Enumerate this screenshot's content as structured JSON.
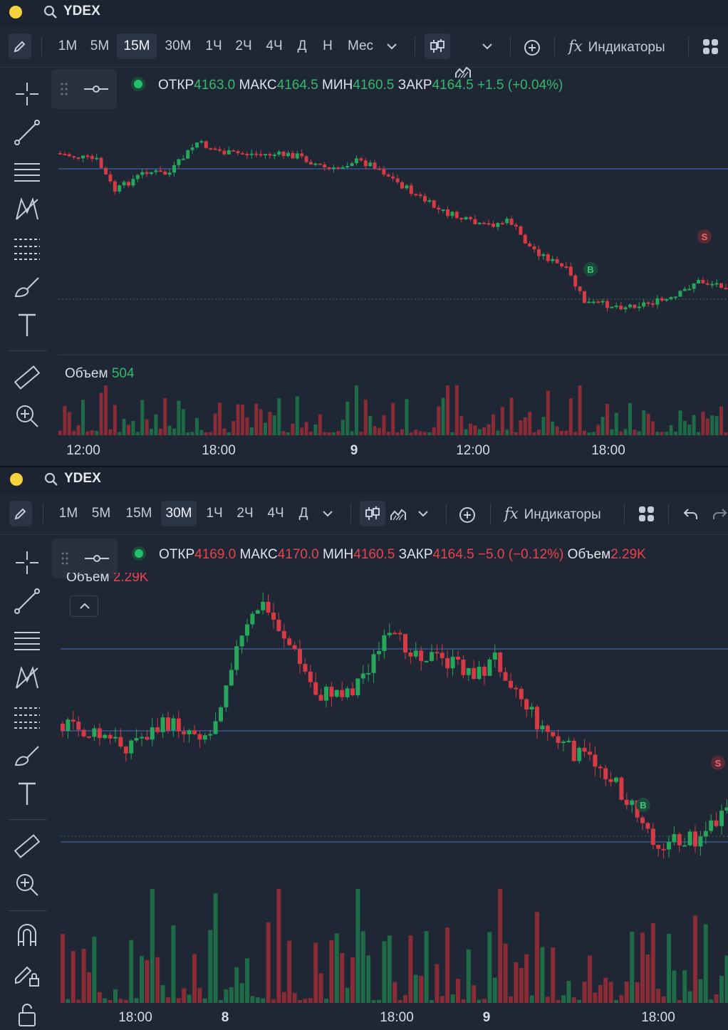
{
  "panels": [
    {
      "ticker": "YDEX",
      "timeframes": [
        "1М",
        "5М",
        "15М",
        "30М",
        "1Ч",
        "2Ч",
        "4Ч",
        "Д",
        "Н",
        "Мес"
      ],
      "active_timeframe": "15М",
      "indicators_label": "Индикаторы",
      "ohlc": {
        "open_label": "ОТКР",
        "open": "4163.0",
        "high_label": "МАКС",
        "high": "4164.5",
        "low_label": "МИН",
        "low": "4160.5",
        "close_label": "ЗАКР",
        "close": "4164.5",
        "change": "+1.5 (+0.04%)",
        "color": "green"
      },
      "volume_label": "Объем",
      "volume_value": "504",
      "x_axis": [
        "12:00",
        "18:00",
        "9",
        "12:00",
        "18:00"
      ],
      "markers": [
        "B",
        "S"
      ]
    },
    {
      "ticker": "YDEX",
      "timeframes": [
        "1М",
        "5М",
        "15М",
        "30М",
        "1Ч",
        "2Ч",
        "4Ч",
        "Д"
      ],
      "active_timeframe": "30М",
      "indicators_label": "Индикаторы",
      "ohlc": {
        "open_label": "ОТКР",
        "open": "4169.0",
        "high_label": "МАКС",
        "high": "4170.0",
        "low_label": "МИН",
        "low": "4160.5",
        "close_label": "ЗАКР",
        "close": "4164.5",
        "change": "−5.0 (−0.12%)",
        "volume_label": "Объем",
        "volume": "2.29K",
        "color": "red"
      },
      "volume_label": "Объем",
      "volume_value": "2.29K",
      "x_axis": [
        "18:00",
        "8",
        "18:00",
        "9",
        "18:00"
      ],
      "markers": [
        "B",
        "S"
      ]
    }
  ],
  "icons": [
    "search-icon",
    "pencil-icon",
    "candles-icon",
    "area-chart-icon",
    "chevron-down-icon",
    "add-compare-icon",
    "fx-icon",
    "layout-grid-icon",
    "undo-icon",
    "redo-icon",
    "crosshair-icon",
    "trend-line-icon",
    "horizontal-lines-icon",
    "pattern-icon",
    "fib-icon",
    "brush-icon",
    "text-icon",
    "ruler-icon",
    "zoom-in-icon",
    "magnet-icon",
    "lock-draw-icon",
    "lock-icon"
  ],
  "colors": {
    "bg": "#1f2735",
    "up": "#26a65b",
    "down": "#d63a45",
    "level": "#3f5fa8",
    "accent_yellow": "#f4d23c"
  }
}
